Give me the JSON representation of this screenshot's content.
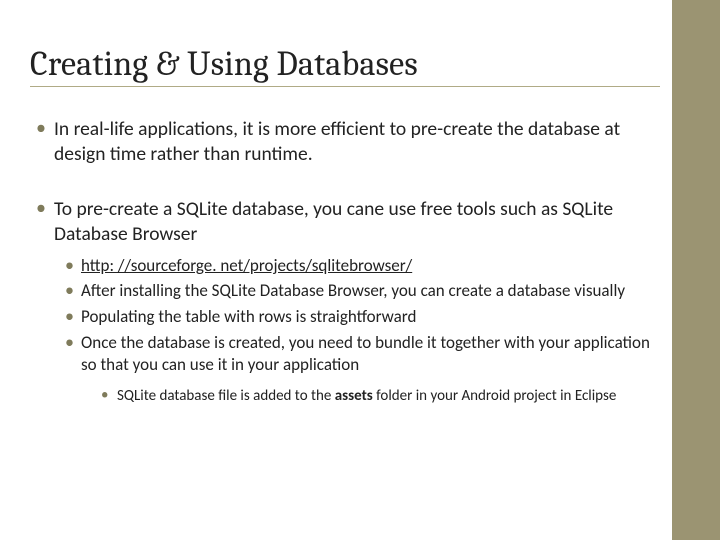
{
  "title": "Creating & Using Databases",
  "bullets": {
    "b1": "In real-life applications, it is more efficient to pre-create the database at design time rather than runtime.",
    "b2": "To pre-create a SQLite database, you cane use free tools such as SQLite Database Browser",
    "sub": {
      "s1_link": "http: //sourceforge. net/projects/sqlitebrowser/",
      "s2": "After installing the SQLite Database Browser, you can create a database visually",
      "s3": "Populating the table with rows is straightforward",
      "s4": "Once the database is created, you need to bundle it together with your application so that you can use it in your application",
      "s4a_pre": "SQLite database file is added to the ",
      "s4a_em": "assets",
      "s4a_post": " folder in your Android project in Eclipse"
    }
  }
}
